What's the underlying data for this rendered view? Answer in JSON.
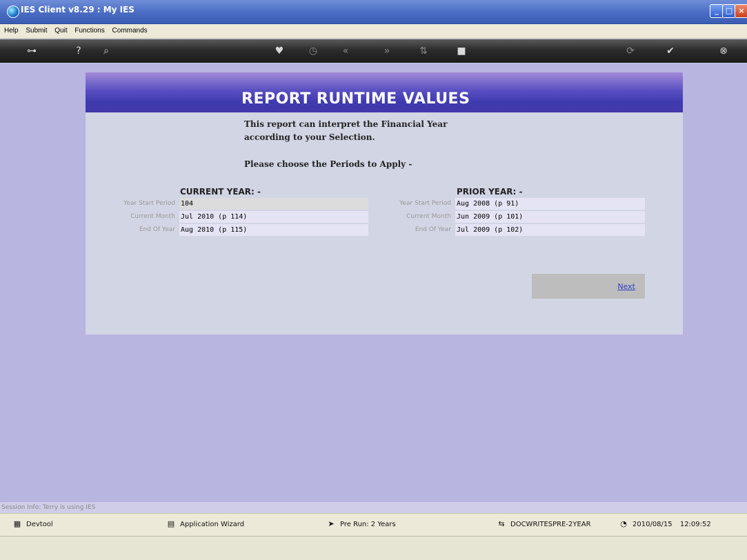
{
  "window": {
    "title": "IES Client v8.29 : My IES"
  },
  "menu": [
    "Help",
    "Submit",
    "Quit",
    "Functions",
    "Commands"
  ],
  "panel": {
    "title": "REPORT RUNTIME VALUES",
    "intro_line1": "This report can interpret the Financial Year",
    "intro_line2": "according to your Selection.",
    "instruction": "Please choose the Periods to Apply -"
  },
  "current_year": {
    "heading": "CURRENT YEAR: -",
    "fields": [
      {
        "label": "Year Start Period",
        "value": "104"
      },
      {
        "label": "Current Month",
        "value": "Jul 2010 (p 114)"
      },
      {
        "label": "End Of Year",
        "value": "Aug 2010 (p 115)"
      }
    ]
  },
  "prior_year": {
    "heading": "PRIOR YEAR: -",
    "fields": [
      {
        "label": "Year Start Period",
        "value": "Aug 2008 (p 91)"
      },
      {
        "label": "Current Month",
        "value": "Jun 2009 (p 101)"
      },
      {
        "label": "End Of Year",
        "value": "Jul 2009 (p 102)"
      }
    ]
  },
  "next_label": "Next",
  "session_info": "Session Info: Terry is using IES",
  "statusbar": {
    "devtool": "Devtool",
    "wizard": "Application Wizard",
    "prerun": "Pre Run: 2 Years",
    "report_code": "DOCWRITESPRE-2YEAR",
    "date": "2010/08/15",
    "time": "12:09:52"
  }
}
